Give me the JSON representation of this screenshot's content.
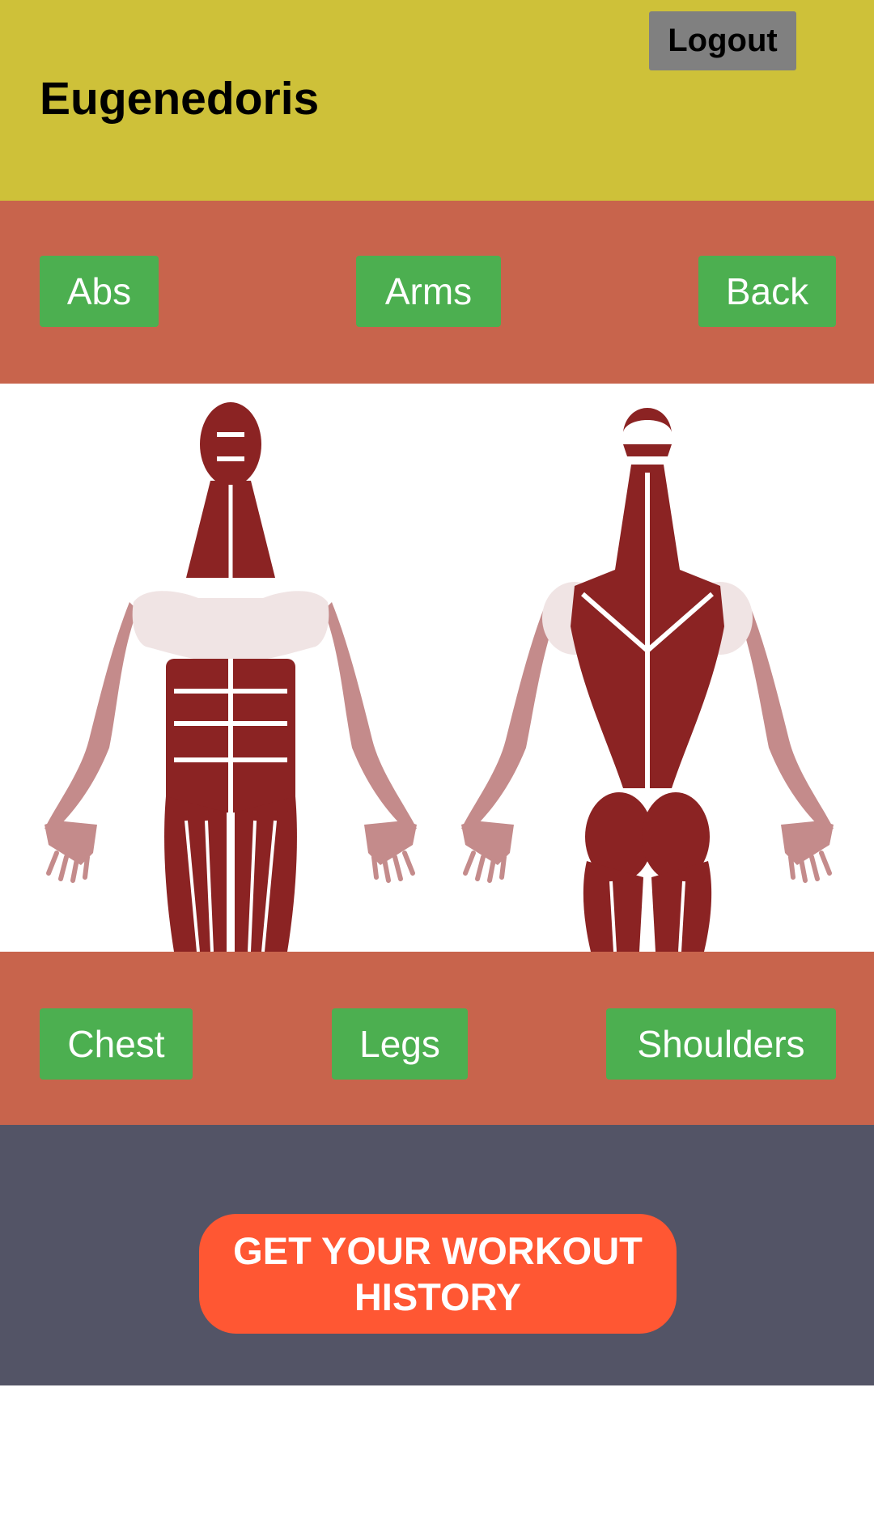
{
  "header": {
    "title": "Eugenedoris",
    "logout_label": "Logout"
  },
  "muscle_groups_top": [
    {
      "label": "Abs"
    },
    {
      "label": "Arms"
    },
    {
      "label": "Back"
    }
  ],
  "muscle_groups_bottom": [
    {
      "label": "Chest"
    },
    {
      "label": "Legs"
    },
    {
      "label": "Shoulders"
    }
  ],
  "figure": {
    "front_icon": "muscle-front-icon",
    "back_icon": "muscle-back-icon"
  },
  "history_button": {
    "label": "GET YOUR WORKOUT HISTORY"
  },
  "colors": {
    "header": "#CEC139",
    "muscle_bar": "#C8644C",
    "muscle_button": "#4CAF50",
    "footer": "#535466",
    "history_button": "#FF5733",
    "muscle_dark": "#8B2323",
    "muscle_light": "#C48B8B",
    "muscle_pale": "#F0E4E4"
  }
}
